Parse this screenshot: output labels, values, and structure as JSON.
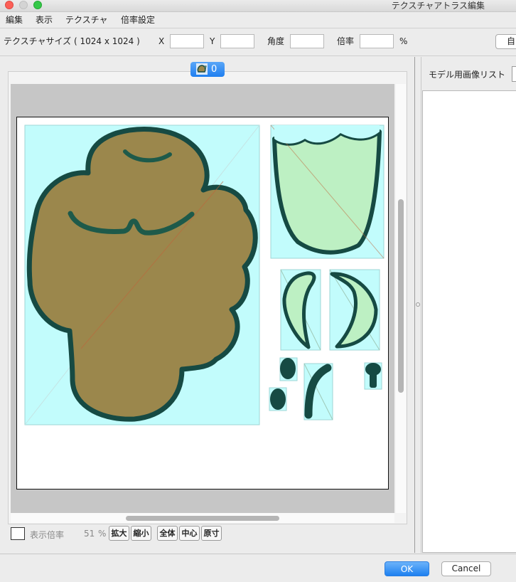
{
  "window": {
    "title": "テクスチャアトラス編集",
    "traffic_light_colors": {
      "close": "#fc5f57",
      "minimize": "#d4d4d4",
      "zoom": "#35c848"
    }
  },
  "menu": [
    "編集",
    "表示",
    "テクスチャ",
    "倍率設定"
  ],
  "toolbar": {
    "texture_size_label": "テクスチャサイズ ( 1024 x 1024 )",
    "x_label": "X",
    "x_value": "",
    "y_label": "Y",
    "y_value": "",
    "angle_label": "角度",
    "angle_value": "",
    "scale_label": "倍率",
    "scale_value": "",
    "percent_unit": "%",
    "auto_button_label": "自"
  },
  "editor": {
    "tab_label": "0",
    "tab_icon": "texture-thumbnail-icon",
    "zoom_label": "表示倍率",
    "zoom_value": "51",
    "zoom_unit": "%",
    "buttons": {
      "zoom_in": "拡大",
      "zoom_out": "縮小",
      "fit_all": "全体",
      "center": "中心",
      "original": "原寸"
    }
  },
  "right_panel": {
    "title": "モデル用画像リスト",
    "items": []
  },
  "dialog": {
    "ok_label": "OK",
    "cancel_label": "Cancel"
  },
  "colors": {
    "accent": "#2a86f2",
    "piece_background": "#c2fcfc",
    "head_fill": "#9b874c",
    "leaf_fill": "#bdf0c3",
    "outline": "#164a43",
    "canvas_gray": "#c6c6c6"
  }
}
